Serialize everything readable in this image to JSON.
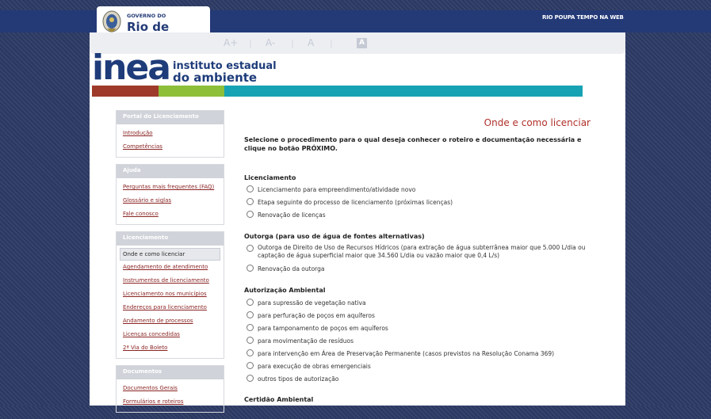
{
  "header": {
    "gov_small": "GOVERNO DO",
    "gov_big": "Rio de Janeiro",
    "right_link": "RIO POUPA TEMPO NA WEB",
    "font_controls": [
      "A+",
      "A-",
      "A",
      "A"
    ]
  },
  "logo": {
    "name": "inea",
    "sub1": "instituto estadual",
    "sub2": "do ambiente"
  },
  "colors": {
    "stripe_red": "#9e3a2a",
    "stripe_green": "#8dbf3a",
    "stripe_teal": "#17a3b4",
    "brand_blue": "#1e3c7a"
  },
  "sidebar": {
    "portal": {
      "title": "Portal do Licenciamento",
      "items": [
        "Introdução",
        "Competências"
      ]
    },
    "ajuda": {
      "title": "Ajuda",
      "items": [
        "Perguntas mais frequentes (FAQ)",
        "Glossário e siglas",
        "Fale conosco"
      ]
    },
    "licenciamento": {
      "title": "Licenciamento",
      "items": [
        "Onde e como licenciar",
        "Agendamento de atendimento",
        "Instrumentos de licenciamento",
        "Licenciamento nos municípios",
        "Endereços para licenciamento",
        "Andamento de processos",
        "Licenças concedidas",
        "2ª Via do Boleto"
      ]
    },
    "documentos": {
      "title": "Documentos",
      "items": [
        "Documentos Gerais",
        "Formulários e roteiros"
      ]
    }
  },
  "main": {
    "title": "Onde e como licenciar",
    "instruction": "Selecione o procedimento para o qual deseja conhecer o roteiro e documentação necessária e clique no botão PRÓXIMO.",
    "sections": {
      "licenciamento": {
        "title": "Licenciamento",
        "options": [
          "Licenciamento para empreendimento/atividade novo",
          "Etapa seguinte do processo de licenciamento (próximas licenças)",
          "Renovação de licenças"
        ]
      },
      "outorga": {
        "title": "Outorga (para uso de água de fontes alternativas)",
        "options": [
          "Outorga de Direito de Uso de Recursos Hídricos (para extração de água subterrânea maior que 5.000 L/dia ou captação de água superficial maior que 34.560 L/dia ou vazão maior que 0,4 L/s)",
          "Renovação da outorga"
        ]
      },
      "autorizacao": {
        "title": "Autorização Ambiental",
        "options": [
          "para supressão de vegetação nativa",
          "para perfuração de poços em aquíferos",
          "para tamponamento de poços em aquíferos",
          "para movimentação de resíduos",
          "para intervenção em Área de Preservação Permanente (casos previstos na Resolução Conama 369)",
          "para execução de obras emergenciais",
          "outros tipos de autorização"
        ]
      },
      "certidao": {
        "title": "Certidão Ambiental"
      }
    }
  }
}
